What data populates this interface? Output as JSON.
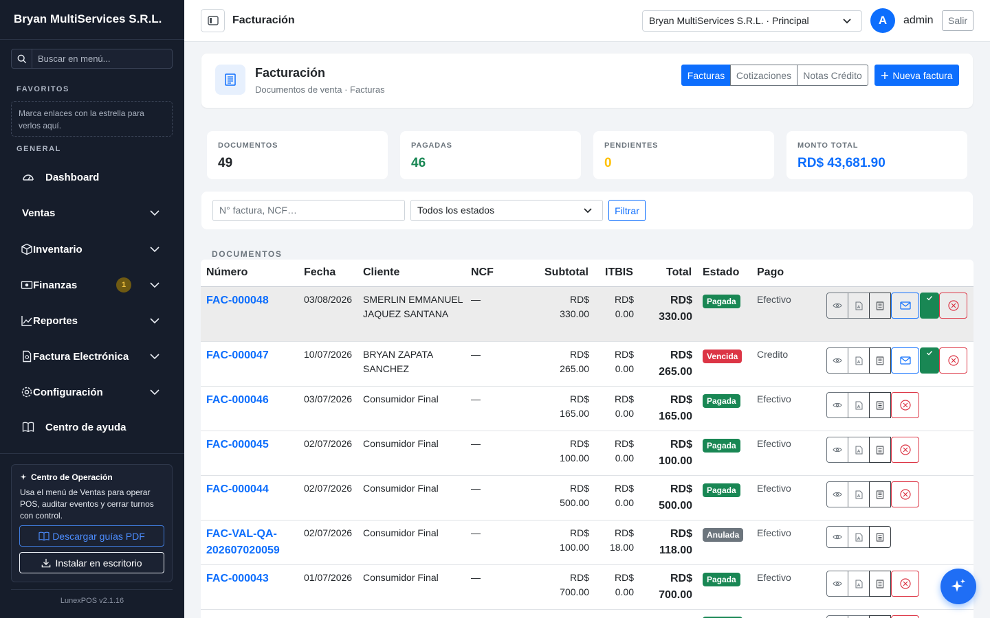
{
  "sidebar": {
    "brand": "Bryan MultiServices S.R.L.",
    "search_placeholder": "Buscar en menú...",
    "favorites_title": "FAVORITOS",
    "favorites_hint": "Marca enlaces con la estrella para verlos aquí.",
    "general_title": "GENERAL",
    "items": [
      {
        "label": "Dashboard",
        "icon": "dashboard-icon"
      },
      {
        "label": "Ventas"
      },
      {
        "label": "Inventario",
        "icon": "box-icon"
      },
      {
        "label": "Finanzas",
        "icon": "cash-icon",
        "badge": "1"
      },
      {
        "label": "Reportes",
        "icon": "chart-icon"
      },
      {
        "label": "Factura Electrónica",
        "icon": "document-icon"
      },
      {
        "label": "Configuración",
        "icon": "gear-icon"
      },
      {
        "label": "Centro de ayuda",
        "icon": "book-icon"
      }
    ],
    "op_card": {
      "title": "Centro de Operación",
      "text": "Usa el menú de Ventas para operar POS, auditar eventos y cerrar turnos con control.",
      "btn_pdf": "Descargar guías PDF",
      "btn_install": "Instalar en escritorio"
    },
    "version": "LunexPOS v2.1.16"
  },
  "topbar": {
    "title": "Facturación",
    "company_select": "Bryan MultiServices S.R.L. · Principal",
    "avatar": "A",
    "user": "admin",
    "logout": "Salir"
  },
  "header": {
    "title": "Facturación",
    "subtitle": "Documentos de venta · Facturas",
    "tabs": [
      "Facturas",
      "Cotizaciones",
      "Notas Crédito"
    ],
    "new_button": "Nueva factura"
  },
  "stats": [
    {
      "label": "DOCUMENTOS",
      "value": "49",
      "color": "#212529"
    },
    {
      "label": "PAGADAS",
      "value": "46",
      "color": "#198754"
    },
    {
      "label": "PENDIENTES",
      "value": "0",
      "color": "#ffc107"
    },
    {
      "label": "MONTO TOTAL",
      "value": "RD$ 43,681.90",
      "color": "#0d6efd"
    }
  ],
  "filter": {
    "search_placeholder": "N° factura, NCF…",
    "status_select": "Todos los estados",
    "button": "Filtrar"
  },
  "table": {
    "section_label": "DOCUMENTOS",
    "headers": [
      "Número",
      "Fecha",
      "Cliente",
      "NCF",
      "Subtotal",
      "ITBIS",
      "Total",
      "Estado",
      "Pago"
    ],
    "rows": [
      {
        "numero": "FAC-000048",
        "fecha": "03/08/2026",
        "cliente": "SMERLIN EMMANUEL JAQUEZ SANTANA",
        "ncf": "—",
        "subtotal": "RD$ 330.00",
        "itbis": "RD$ 0.00",
        "total": "RD$ 330.00",
        "estado": "Pagada",
        "estado_color": "#198754",
        "pago": "Efectivo"
      },
      {
        "numero": "FAC-000047",
        "fecha": "10/07/2026",
        "cliente": "BRYAN ZAPATA SANCHEZ",
        "ncf": "—",
        "subtotal": "RD$ 265.00",
        "itbis": "RD$ 0.00",
        "total": "RD$ 265.00",
        "estado": "Vencida",
        "estado_color": "#dc3545",
        "pago": "Credito"
      },
      {
        "numero": "FAC-000046",
        "fecha": "03/07/2026",
        "cliente": "Consumidor Final",
        "ncf": "—",
        "subtotal": "RD$ 165.00",
        "itbis": "RD$ 0.00",
        "total": "RD$ 165.00",
        "estado": "Pagada",
        "estado_color": "#198754",
        "pago": "Efectivo"
      },
      {
        "numero": "FAC-000045",
        "fecha": "02/07/2026",
        "cliente": "Consumidor Final",
        "ncf": "—",
        "subtotal": "RD$ 100.00",
        "itbis": "RD$ 0.00",
        "total": "RD$ 100.00",
        "estado": "Pagada",
        "estado_color": "#198754",
        "pago": "Efectivo"
      },
      {
        "numero": "FAC-000044",
        "fecha": "02/07/2026",
        "cliente": "Consumidor Final",
        "ncf": "—",
        "subtotal": "RD$ 500.00",
        "itbis": "RD$ 0.00",
        "total": "RD$ 500.00",
        "estado": "Pagada",
        "estado_color": "#198754",
        "pago": "Efectivo"
      },
      {
        "numero": "FAC-VAL-QA-202607020059",
        "fecha": "02/07/2026",
        "cliente": "Consumidor Final",
        "ncf": "—",
        "subtotal": "RD$ 100.00",
        "itbis": "RD$ 18.00",
        "total": "RD$ 118.00",
        "estado": "Anulada",
        "estado_color": "#6c757d",
        "pago": "Efectivo"
      },
      {
        "numero": "FAC-000043",
        "fecha": "01/07/2026",
        "cliente": "Consumidor Final",
        "ncf": "—",
        "subtotal": "RD$ 700.00",
        "itbis": "RD$ 0.00",
        "total": "RD$ 700.00",
        "estado": "Pagada",
        "estado_color": "#198754",
        "pago": "Efectivo"
      }
    ]
  }
}
